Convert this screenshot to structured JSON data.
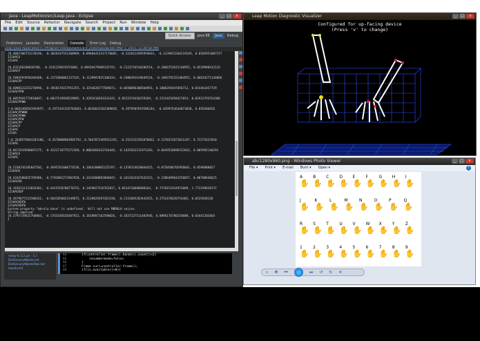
{
  "eclipse": {
    "title": "Java - LeapMotion/src/Leap.java - Eclipse",
    "menu": [
      "File",
      "Edit",
      "Source",
      "Refactor",
      "Navigate",
      "Search",
      "Project",
      "Run",
      "Window",
      "Help"
    ],
    "quick_access": "Quick Access",
    "perspectives": [
      "Java EE",
      "Java",
      "Debug"
    ],
    "tabs": [
      "Problems",
      "Javadoc",
      "Declaration",
      "Console",
      "Error Log",
      "Debug"
    ],
    "console_path": "Leap [Java Application] C:\\Program Files\\Java\\jre1.8.0_25\\bin\\javaw.exe (Mar 1, 2015, 11:38:58 AM)",
    "console_lines": [
      "[0.4607206751170196, -0.3026197551268969, 0.09604412317176005, -0.3220121995959033, -0.1239651504219249, 0.0505951007157",
      "321HACU",
      "321HAC",
      "",
      "[0.632166206036700, -0.1541239619255066, 0.09456479489135742, -0.2123724520206514, -0.2066753615140955, 0.0539998412132",
      "321HACP",
      "",
      "[0.5094593950204468, -0.2372068061237335, 0.1139997025100334, -0.2408391419649124, -0.1893792152404952, 0.06634271144866",
      "321HACPP",
      "",
      "[0.6098122215270996, -0.3918176157951355, 0.3254620777509673, -0.0658096300504991, 0.1888359447056712, 0.014461457729",
      "321HACPPW",
      "",
      "[0.6055941773010097, -0.6037519930529095, 0.4291610393333435, 0.0522374436259269, -0.2531425058417053, 0.01923793554306",
      "321HACPPWW",
      "",
      "[-0.0601468541954957, -0.2973341345703043, 0.0616641502309058, -0.3979505919396244, -0.0399763644073038, 0.058306626",
      "321HACPPWWW",
      "321HACPPWW",
      "321HACPPW",
      "321HACPP",
      "321HACP",
      "321HAC",
      "321HA",
      "",
      "[-0.2640579644203186, -0.2670000903905792, 0.5047072495651245, -0.2521531581870662, 0.1370252072011267, 0.72272437010",
      "321HAC",
      "",
      "[0.0672919500097275, -0.4222718775272369, 0.0001666342764446, -0.1425832211971203, -0.0449528696152032, 0.005992140291",
      "321HACU",
      "321HAC",
      "",
      "",
      "[0.2230316185047502, -0.4695761600774536, 0.1664200065225197, -0.1359314620044425, -0.0750586705950041, 0.0596800827",
      "321HACK",
      "",
      "[0.4244586025705986, -0.5792081273962928, 0.3433480092060645, -0.3413624167642322, -0.2386499643258057, 0.00700646625",
      "321HACKD",
      "",
      "[0.1636311113034381, -0.6415558700770752, 0.1459027526762817, 0.0534710680680164, -0.7570151914951089, 1.772199620737",
      "321HACKDF",
      "",
      "[0.3679077221586432, -0.6641850823149872, 0.2139829397281538, -0.2115685283441925, 0.2752478420754405, 0.0525830136",
      "321HACKDFW",
      "321HACKDFW",
      "System property \"mbrola.base\" is undefined.  Will not use MBROLA voices.",
      "String emptied",
      "[0.3795729615760803, -0.5763105620307922, 0.1818907162590026, -0.1037227511405946, 0.0096176780210688, 0.03441202664",
      "2"
    ],
    "package_items": [
      "resty-0.3.2.jar - C:\\",
      "DictionaryWords.txt",
      "DictionaryWordsTwo.txt",
      "hands.txt"
    ],
    "code_lines": [
      {
        "n": "64",
        "code": "if(controller.frame().hands().count()<2)"
      },
      {
        "n": "65",
        "code": "    innumbermode=false;"
      },
      {
        "n": "66",
        "code": "}"
      },
      {
        "n": "67",
        "code": "Frame curr=controller.frame();"
      },
      {
        "n": "68",
        "code": "if(in.available()>0){"
      }
    ]
  },
  "leap": {
    "title": "Leap Motion Diagnostic Visualizer",
    "line1": "Configured for up-facing device",
    "line2": "(Press 'v' to change)"
  },
  "photo": {
    "title": "abc1280x960.png - Windows Photo Viewer",
    "menu": [
      "File ▾",
      "Print ▾",
      "E-mail",
      "Burn ▾",
      "Open ▾"
    ],
    "help": "?",
    "letters": [
      "A",
      "B",
      "C",
      "D",
      "E",
      "F",
      "G",
      "H",
      "I",
      "J",
      "K",
      "L",
      "M",
      "N",
      "O",
      "P",
      "Q",
      "R",
      "S",
      "T",
      "U",
      "V",
      "W",
      "X",
      "Y",
      "Z",
      "1",
      "2",
      "3",
      "4",
      "5",
      "6",
      "7",
      "8",
      "9"
    ],
    "nav": [
      "⌕",
      "✥",
      "⏮",
      "⏭",
      "↺",
      "↻",
      "✕"
    ]
  }
}
